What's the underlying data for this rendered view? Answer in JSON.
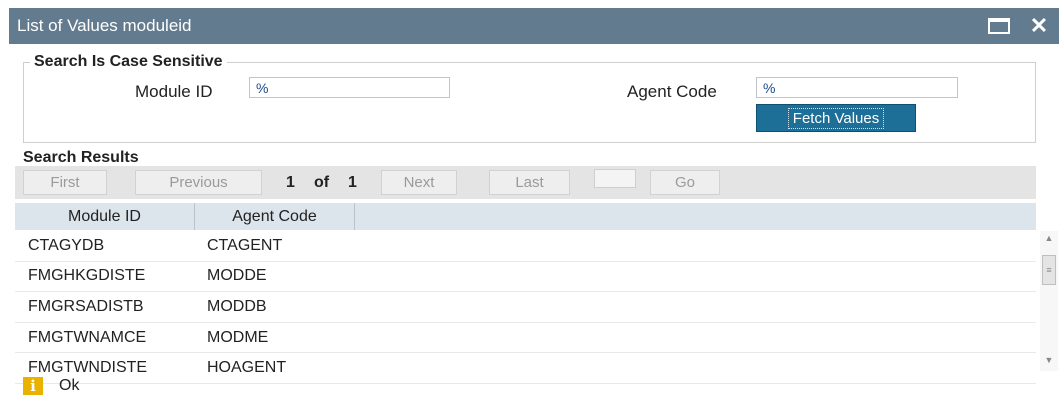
{
  "window": {
    "title": "List of Values moduleid"
  },
  "titlebar": {
    "maximize_icon": "maximize-icon",
    "close_icon": "close-icon",
    "close_glyph": "✕"
  },
  "search": {
    "legend": "Search Is Case Sensitive",
    "module_id": {
      "label": "Module ID",
      "value": "%"
    },
    "agent_code": {
      "label": "Agent Code",
      "value": "%"
    },
    "fetch_label": "Fetch Values"
  },
  "results": {
    "label": "Search Results",
    "pager": {
      "first": "First",
      "previous": "Previous",
      "current": "1",
      "of": "of",
      "total": "1",
      "next": "Next",
      "last": "Last",
      "go": "Go"
    },
    "columns": [
      "Module ID",
      "Agent Code"
    ],
    "rows": [
      {
        "module_id": "CTAGYDB",
        "agent_code": "CTAGENT"
      },
      {
        "module_id": "FMGHKGDISTE",
        "agent_code": "MODDE"
      },
      {
        "module_id": "FMGRSADISTB",
        "agent_code": "MODDB"
      },
      {
        "module_id": "FMGTWNAMCE",
        "agent_code": "MODME"
      },
      {
        "module_id": "FMGTWNDISTE",
        "agent_code": "HOAGENT"
      }
    ]
  },
  "footer": {
    "info_glyph": "i",
    "ok_label": "Ok"
  },
  "colors": {
    "titlebar": "#627b8f",
    "accent": "#1d6f98",
    "header": "#dce5ec",
    "info": "#e9b200"
  }
}
